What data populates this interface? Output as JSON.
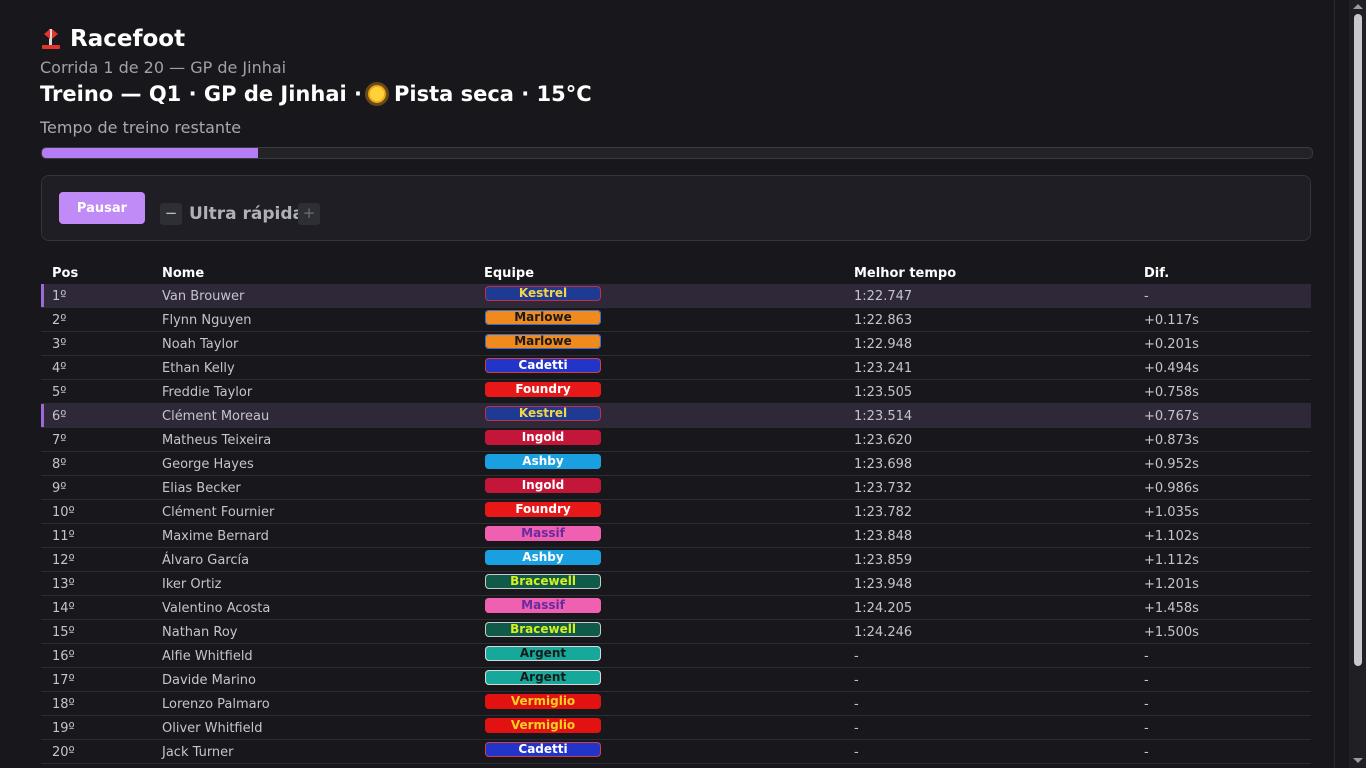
{
  "brand": {
    "name": "Racefoot",
    "icon": "podium-flag-icon"
  },
  "subtitle": "Corrida 1 de 20 — GP de Jinhai",
  "session": {
    "prefix": "Treino — Q1 · GP de Jinhai ·",
    "weather_icon": "sun-icon",
    "suffix": "Pista seca · 15°C"
  },
  "timer": {
    "label": "Tempo de treino restante",
    "progress": 0.17,
    "color": "#b57cf5"
  },
  "controls": {
    "pause_label": "Pausar",
    "speed_minus": "−",
    "speed_label": "Ultra rápida",
    "speed_plus": "+"
  },
  "table": {
    "headers": {
      "pos": "Pos",
      "name": "Nome",
      "team": "Equipe",
      "best": "Melhor tempo",
      "gap": "Dif."
    },
    "rows": [
      {
        "pos": "1º",
        "name": "Van Brouwer",
        "team": "Kestrel",
        "best": "1:22.747",
        "gap": "-",
        "highlight": true
      },
      {
        "pos": "2º",
        "name": "Flynn Nguyen",
        "team": "Marlowe",
        "best": "1:22.863",
        "gap": "+0.117s"
      },
      {
        "pos": "3º",
        "name": "Noah Taylor",
        "team": "Marlowe",
        "best": "1:22.948",
        "gap": "+0.201s"
      },
      {
        "pos": "4º",
        "name": "Ethan Kelly",
        "team": "Cadetti",
        "best": "1:23.241",
        "gap": "+0.494s"
      },
      {
        "pos": "5º",
        "name": "Freddie Taylor",
        "team": "Foundry",
        "best": "1:23.505",
        "gap": "+0.758s"
      },
      {
        "pos": "6º",
        "name": "Clément Moreau",
        "team": "Kestrel",
        "best": "1:23.514",
        "gap": "+0.767s",
        "highlight": true
      },
      {
        "pos": "7º",
        "name": "Matheus Teixeira",
        "team": "Ingold",
        "best": "1:23.620",
        "gap": "+0.873s"
      },
      {
        "pos": "8º",
        "name": "George Hayes",
        "team": "Ashby",
        "best": "1:23.698",
        "gap": "+0.952s"
      },
      {
        "pos": "9º",
        "name": "Elias Becker",
        "team": "Ingold",
        "best": "1:23.732",
        "gap": "+0.986s"
      },
      {
        "pos": "10º",
        "name": "Clément Fournier",
        "team": "Foundry",
        "best": "1:23.782",
        "gap": "+1.035s"
      },
      {
        "pos": "11º",
        "name": "Maxime Bernard",
        "team": "Massif",
        "best": "1:23.848",
        "gap": "+1.102s"
      },
      {
        "pos": "12º",
        "name": "Álvaro García",
        "team": "Ashby",
        "best": "1:23.859",
        "gap": "+1.112s"
      },
      {
        "pos": "13º",
        "name": "Iker Ortiz",
        "team": "Bracewell",
        "best": "1:23.948",
        "gap": "+1.201s"
      },
      {
        "pos": "14º",
        "name": "Valentino Acosta",
        "team": "Massif",
        "best": "1:24.205",
        "gap": "+1.458s"
      },
      {
        "pos": "15º",
        "name": "Nathan Roy",
        "team": "Bracewell",
        "best": "1:24.246",
        "gap": "+1.500s"
      },
      {
        "pos": "16º",
        "name": "Alfie Whitfield",
        "team": "Argent",
        "best": "-",
        "gap": "-"
      },
      {
        "pos": "17º",
        "name": "Davide Marino",
        "team": "Argent",
        "best": "-",
        "gap": "-"
      },
      {
        "pos": "18º",
        "name": "Lorenzo Palmaro",
        "team": "Vermiglio",
        "best": "-",
        "gap": "-"
      },
      {
        "pos": "19º",
        "name": "Oliver Whitfield",
        "team": "Vermiglio",
        "best": "-",
        "gap": "-"
      },
      {
        "pos": "20º",
        "name": "Jack Turner",
        "team": "Cadetti",
        "best": "-",
        "gap": "-"
      }
    ]
  },
  "team_colors": {
    "Kestrel": {
      "bg": "#1f3a93",
      "fg": "#f5d547",
      "border": "#c0304a"
    },
    "Marlowe": {
      "bg": "#f08a1c",
      "fg": "#1a1a1a",
      "border": "#3a6fd8"
    },
    "Cadetti": {
      "bg": "#2235c8",
      "fg": "#ffffff",
      "border": "#d04040"
    },
    "Foundry": {
      "bg": "#e81818",
      "fg": "#ffffff",
      "border": "#e81818"
    },
    "Ingold": {
      "bg": "#c41638",
      "fg": "#ffffff",
      "border": "#c41638"
    },
    "Ashby": {
      "bg": "#1aa0e0",
      "fg": "#ffffff",
      "border": "#1aa0e0"
    },
    "Massif": {
      "bg": "#f060b0",
      "fg": "#6a2aa0",
      "border": "#f060b0"
    },
    "Bracewell": {
      "bg": "#0f5a48",
      "fg": "#d8f020",
      "border": "#c8c8c8"
    },
    "Argent": {
      "bg": "#16a89a",
      "fg": "#1a1a1a",
      "border": "#d8d8d8"
    },
    "Vermiglio": {
      "bg": "#e21212",
      "fg": "#f5d020",
      "border": "#e21212"
    }
  }
}
